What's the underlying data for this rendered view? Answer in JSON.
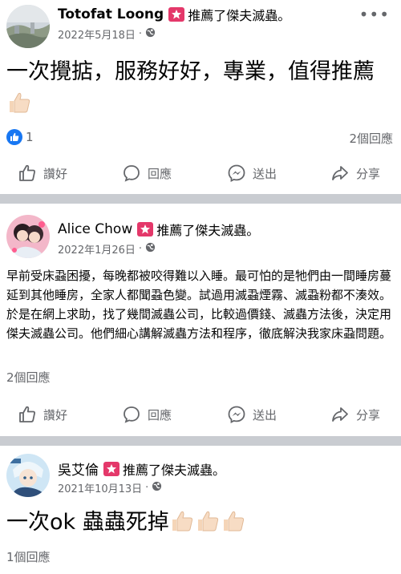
{
  "recommend_text": "推薦了傑夫滅蟲。",
  "actions": {
    "like": "讚好",
    "comment": "回應",
    "send": "送出",
    "share": "分享"
  },
  "posts": [
    {
      "author": "Totofat Loong",
      "date": "2022年5月18日",
      "separator": "·",
      "text": "一次攪掂，服務好好，專業，值得推薦",
      "thumbs": 1,
      "reaction_count": "1",
      "comment_count": "2個回應"
    },
    {
      "author": "Alice Chow",
      "date": "2022年1月26日",
      "separator": "·",
      "text": "早前受床蝨困擾，每晚都被咬得難以入睡。最可怕的是牠們由一間睡房蔓延到其他睡房，全家人都聞蝨色變。試過用滅蝨煙霧、滅蝨粉都不湊效。於是在網上求助，找了幾間滅蟲公司，比較過價錢、滅蟲方法後，決定用傑夫滅蟲公司。他們細心講解滅蟲方法和程序，徹底解決我家床蝨問題。",
      "comment_count": "2個回應"
    },
    {
      "author": "吳艾倫",
      "date": "2021年10月13日",
      "separator": "·",
      "text": "一次ok 蟲蟲死掉",
      "thumbs": 3,
      "comment_count": "1個回應"
    }
  ],
  "colors": {
    "accent": "#1877f2",
    "badge": "#e4386a",
    "muted": "#65676b",
    "divider": "#c9ccd1"
  },
  "icons": [
    "like-outline-icon",
    "comment-icon",
    "messenger-icon",
    "share-icon",
    "globe-icon",
    "more-icon",
    "recommend-badge-icon",
    "thumbs-up-emoji"
  ]
}
